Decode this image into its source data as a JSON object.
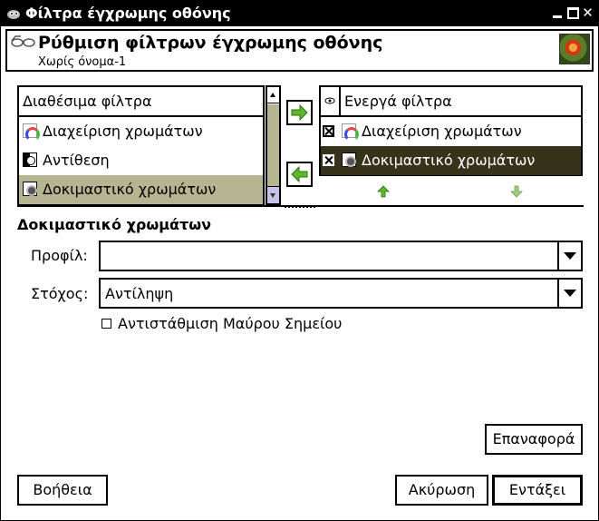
{
  "window": {
    "title": "Φίλτρα έγχρωμης οθόνης",
    "controls": {
      "minimize": "minimize",
      "maximize": "maximize",
      "close": "✕"
    }
  },
  "header": {
    "title": "Ρύθμιση φίλτρων έγχρωμης οθόνης",
    "subtitle": "Χωρίς όνομα-1"
  },
  "available_filters": {
    "heading": "Διαθέσιμα φίλτρα",
    "items": [
      {
        "label": "Διαχείριση χρωμάτων",
        "icon": "color-management-icon"
      },
      {
        "label": "Αντίθεση",
        "icon": "contrast-icon"
      },
      {
        "label": "Δοκιμαστικό χρωμάτων",
        "icon": "proof-icon",
        "selected": true
      }
    ]
  },
  "active_filters": {
    "heading": "Ενεργά φίλτρα",
    "visibility_icon": "eye-icon",
    "items": [
      {
        "label": "Διαχείριση χρωμάτων",
        "icon": "color-management-icon",
        "enabled": true
      },
      {
        "label": "Δοκιμαστικό χρωμάτων",
        "icon": "proof-icon",
        "enabled": true,
        "selected": true
      }
    ]
  },
  "section": {
    "title": "Δοκιμαστικό χρωμάτων",
    "profile_label": "Προφίλ:",
    "profile_value": "",
    "intent_label": "Στόχος:",
    "intent_value": "Αντίληψη",
    "bpc_label": "Αντιστάθμιση Μαύρου Σημείου",
    "bpc_checked": false
  },
  "buttons": {
    "reset": "Επαναφορά",
    "help": "Βοήθεια",
    "cancel": "Ακύρωση",
    "ok": "Εντάξει"
  },
  "colors": {
    "selection_light": "#b7b492",
    "selection_dark": "#37321a",
    "arrow_green": "#5cb82a",
    "titlebar": "#000000"
  }
}
